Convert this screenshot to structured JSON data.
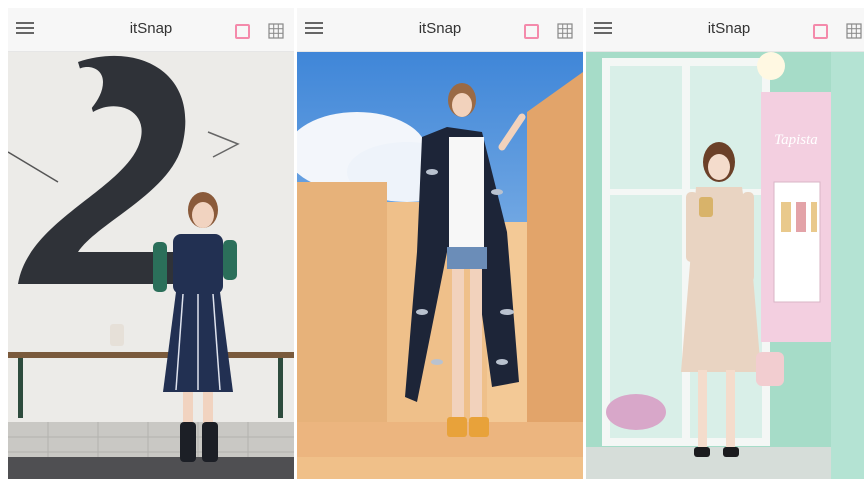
{
  "screens": [
    {
      "id": "screen-1",
      "title": "itSnap"
    },
    {
      "id": "screen-2",
      "title": "itSnap"
    },
    {
      "id": "screen-3",
      "title": "itSnap"
    }
  ],
  "store_sign": "Tapista",
  "icons": {
    "menu": "hamburger-menu-icon",
    "single_view": "single-view-icon",
    "grid_view": "grid-view-icon"
  },
  "colors": {
    "accent": "#f48aab",
    "topbar": "#f7f7f7",
    "icon_gray": "#666666"
  }
}
